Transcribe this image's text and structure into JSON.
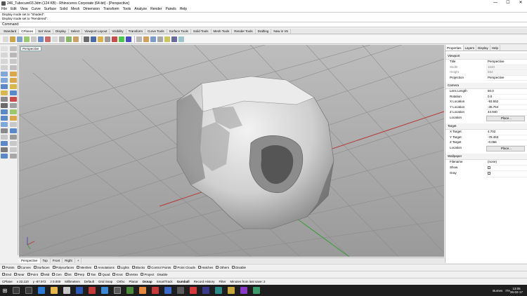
{
  "window": {
    "title": "246_Tubocure03.3dm (124 KB) - Rhinoceros Corporate (64-bit) - [Perspective]",
    "minimize": "—",
    "maximize": "☐",
    "close": "✕"
  },
  "menu": [
    "File",
    "Edit",
    "View",
    "Curve",
    "Surface",
    "Solid",
    "Mesh",
    "Dimension",
    "Transform",
    "Tools",
    "Analyze",
    "Render",
    "Panels",
    "Help"
  ],
  "command_history": [
    "Display mode set to \"Shaded\".",
    "Display mode set to \"Rendered\"."
  ],
  "command_prompt": "Command:",
  "toolbar_tabs": [
    "Standard",
    "CPlanes",
    "Set View",
    "Display",
    "Select",
    "Viewport Layout",
    "Visibility",
    "Transform",
    "Curve Tools",
    "Surface Tools",
    "Solid Tools",
    "Mesh Tools",
    "Render Tools",
    "Drafting",
    "New in V5"
  ],
  "active_toolbar_tab": "CPlanes",
  "viewport": {
    "label": "Perspective",
    "tabs": [
      "Perspective",
      "Top",
      "Front",
      "Right",
      "+"
    ]
  },
  "panel": {
    "tabs": [
      "Properties",
      "Layers",
      "Display",
      "Help"
    ],
    "viewport_section": "Viewport",
    "title_label": "Title",
    "title_value": "Perspective",
    "width_label": "Width",
    "width_value": "1040",
    "height_label": "Height",
    "height_value": "552",
    "projection_label": "Projection",
    "projection_value": "Perspective",
    "camera_section": "Camera",
    "lens_label": "Lens Length",
    "lens_value": "50.0",
    "rotation_label": "Rotation",
    "rotation_value": "0.0",
    "xloc_label": "X Location",
    "xloc_value": "-93.552",
    "yloc_label": "Y Location",
    "yloc_value": "-35.764",
    "zloc_label": "Z Location",
    "zloc_value": "44.940",
    "location_label": "Location",
    "location_btn": "Place...",
    "target_section": "Target",
    "xt_label": "X Target",
    "xt_value": "4.702",
    "yt_label": "Y Target",
    "yt_value": "-78.463",
    "zt_label": "Z Target",
    "zt_value": "-0.066",
    "tloc_label": "Location",
    "tloc_btn": "Place...",
    "wallpaper_section": "Wallpaper",
    "filename_label": "Filename",
    "filename_value": "(none)",
    "show_label": "Show",
    "gray_label": "Gray"
  },
  "filters": [
    "Points",
    "Curves",
    "Surfaces",
    "Polysurfaces",
    "Meshes",
    "Annotations",
    "Lights",
    "Blocks",
    "Control Points",
    "Point Clouds",
    "Hatches",
    "Others",
    "Disable"
  ],
  "osnaps": [
    "End",
    "Near",
    "Point",
    "Mid",
    "Cen",
    "Int",
    "Perp",
    "Tan",
    "Quad",
    "Knot",
    "Vertex",
    "Project",
    "Disable"
  ],
  "status": {
    "cplane": "CPlane",
    "x": "x 22.110",
    "y": "y -87.972",
    "z": "z 0.000",
    "units": "Millimeters",
    "layer": "Default",
    "grid_snap": "Grid Snap",
    "ortho": "Ortho",
    "planar": "Planar",
    "osnap": "Osnap",
    "smarttrack": "SmartTrack",
    "gumball": "Gumball",
    "record_history": "Record History",
    "filter": "Filter",
    "save_msg": "Minutes from last save: 2"
  },
  "taskbar": {
    "weather": "Bumes",
    "time": "13:05",
    "date": "26-02-17",
    "lang": "ITA"
  },
  "colors": {
    "viewport_bg": "#a9a9a9",
    "axis_x": "#b33a3a",
    "axis_y": "#3a9a3a",
    "taskbar": "#1e1e1e"
  }
}
